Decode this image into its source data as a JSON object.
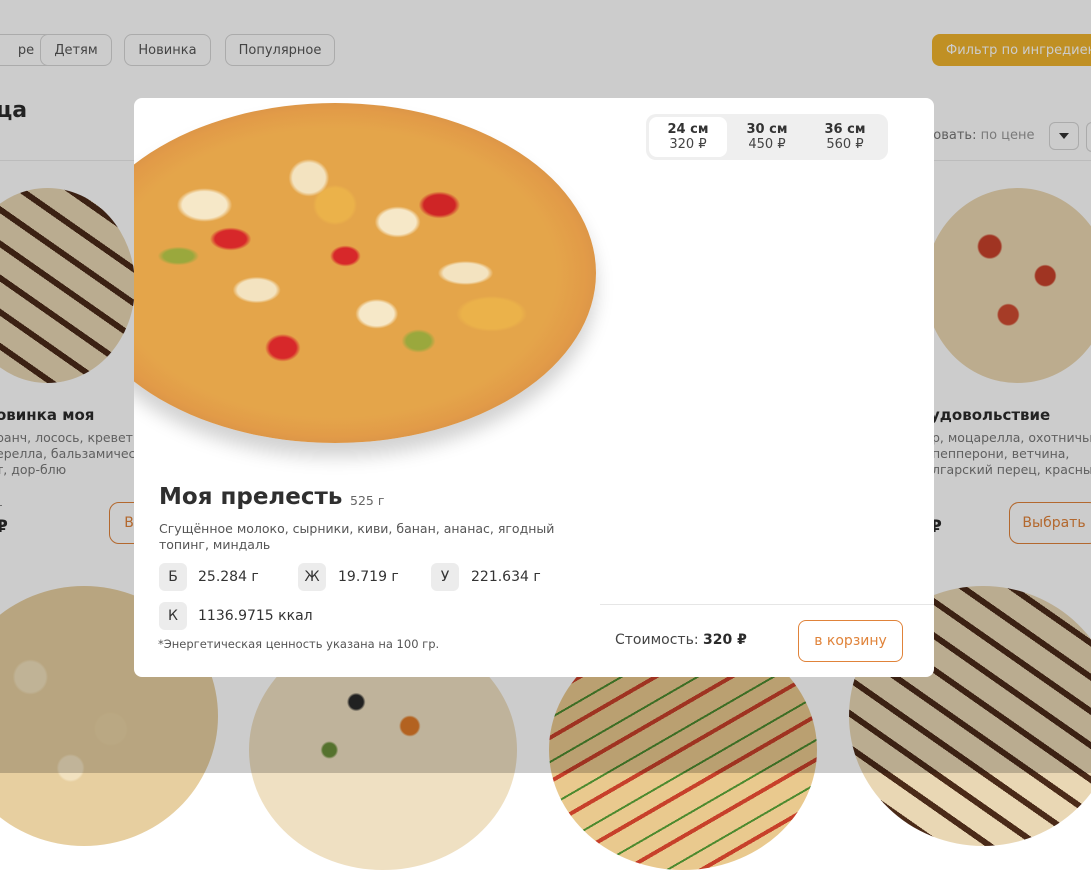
{
  "filters": {
    "chips": [
      "ре",
      "Детям",
      "Новинка",
      "Популярное"
    ],
    "ingredient_filter_label": "Фильтр по ингредиентам"
  },
  "section_title": "ца",
  "sort": {
    "label": "ровать:",
    "value": "по цене"
  },
  "bg_products": [
    {
      "name": "овинка моя",
      "desc": [
        "ранч, лосось, креветка",
        "ерелла, бальзамичес",
        "т, дор-блю"
      ],
      "price": "₽",
      "price_prefix": "г",
      "button": "В"
    },
    {
      "name": "удовольствие",
      "desc": [
        "р, моцарелла, охотничьи",
        "пепперони, ветчина,",
        "лгарский перец, красный"
      ],
      "price": "₽",
      "button": "Выбрать"
    }
  ],
  "modal": {
    "title": "Моя прелесть",
    "weight": "525 г",
    "description": "Сгущённое молоко, сырники, киви, банан, ананас, ягодный топинг, миндаль",
    "nutrition": [
      {
        "letter": "Б",
        "value": "25.284 г"
      },
      {
        "letter": "Ж",
        "value": "19.719 г"
      },
      {
        "letter": "У",
        "value": "221.634 г"
      },
      {
        "letter": "К",
        "value": "1136.9715 ккал"
      }
    ],
    "note": "*Энергетическая ценность указана на 100 гр.",
    "sizes": [
      {
        "size": "24 см",
        "price": "320 ₽",
        "selected": true
      },
      {
        "size": "30 см",
        "price": "450 ₽",
        "selected": false
      },
      {
        "size": "36 см",
        "price": "560 ₽",
        "selected": false
      }
    ],
    "cost_label": "Стоимость:",
    "cost_value": "320 ₽",
    "cart_button": "в корзину"
  },
  "colors": {
    "accent": "#e0833a",
    "filter_button": "#f1b52d",
    "overlay": "rgba(0,0,0,0.2)"
  }
}
